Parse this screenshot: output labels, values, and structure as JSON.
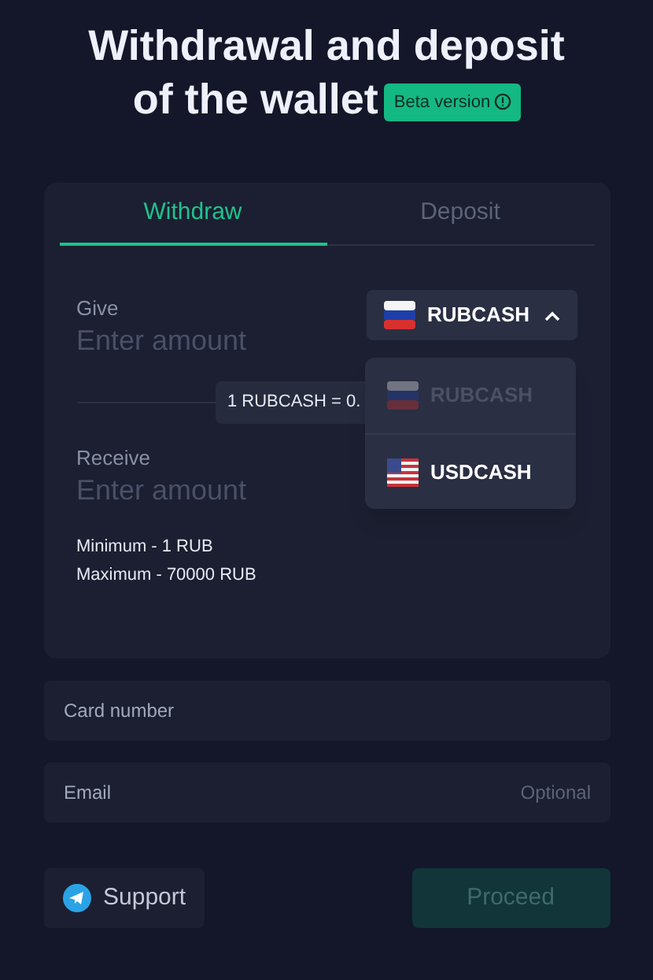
{
  "title": "Withdrawal and deposit of the wallet",
  "badge": {
    "label": "Beta version"
  },
  "tabs": [
    {
      "label": "Withdraw",
      "selected": true
    },
    {
      "label": "Deposit",
      "selected": false
    }
  ],
  "give": {
    "label": "Give",
    "placeholder": "Enter amount"
  },
  "currency_select": {
    "value": "RUBCASH",
    "kind": "ru",
    "expanded": true
  },
  "currency_options": [
    {
      "label": "RUBCASH",
      "kind": "ru",
      "selected": true
    },
    {
      "label": "USDCASH",
      "kind": "us",
      "selected": false
    }
  ],
  "rate": "1 RUBCASH = 0.",
  "receive": {
    "label": "Receive",
    "placeholder": "Enter amount"
  },
  "limits": [
    "Minimum - 1 RUB",
    "Maximum - 70000 RUB"
  ],
  "card_field": {
    "placeholder": "Card number"
  },
  "email_field": {
    "placeholder": "Email",
    "hint": "Optional"
  },
  "support_button": "Support",
  "proceed_button": {
    "label": "Proceed",
    "disabled": true
  }
}
